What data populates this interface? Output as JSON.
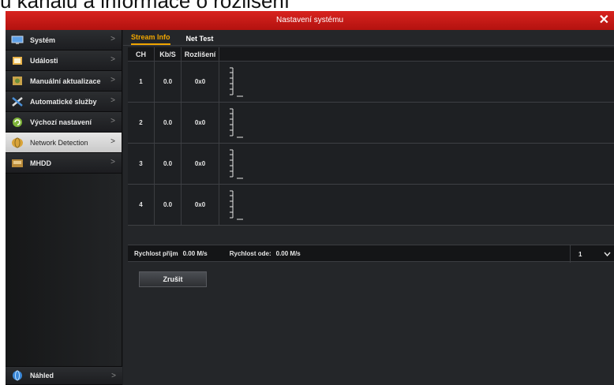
{
  "caption": "u kanálů a informace o rozlišení",
  "window": {
    "title": "Nastavení systému",
    "close": "✕"
  },
  "sidebar": {
    "items": [
      {
        "label": "Systém",
        "icon": "computer-icon"
      },
      {
        "label": "Události",
        "icon": "folder-icon"
      },
      {
        "label": "Manuální aktualizace",
        "icon": "update-icon"
      },
      {
        "label": "Automatické služby",
        "icon": "tools-icon"
      },
      {
        "label": "Výchozí nastavení",
        "icon": "refresh-icon"
      },
      {
        "label": "Network Detection",
        "icon": "network-icon",
        "active": true
      },
      {
        "label": "MHDD",
        "icon": "disk-icon"
      }
    ],
    "bottom": {
      "label": "Náhled",
      "icon": "globe-icon"
    }
  },
  "tabs": [
    {
      "label": "Stream Info",
      "active": true
    },
    {
      "label": "Net Test",
      "active": false
    }
  ],
  "table": {
    "headers": [
      "CH",
      "Kb/S",
      "Rozlišení",
      ""
    ],
    "rows": [
      {
        "ch": "1",
        "kbs": "0.0",
        "res": "0x0"
      },
      {
        "ch": "2",
        "kbs": "0.0",
        "res": "0x0"
      },
      {
        "ch": "3",
        "kbs": "0.0",
        "res": "0x0"
      },
      {
        "ch": "4",
        "kbs": "0.0",
        "res": "0x0"
      }
    ]
  },
  "info": {
    "rx_label": "Rychlost příjm",
    "rx_value": "0.00 M/s",
    "tx_label": "Rychlost ode:",
    "tx_value": "0.00 M/s",
    "page_select": "1"
  },
  "buttons": {
    "cancel": "Zrušit"
  },
  "colors": {
    "titlebar": "#c8181a",
    "active_tab": "#f0a500"
  }
}
